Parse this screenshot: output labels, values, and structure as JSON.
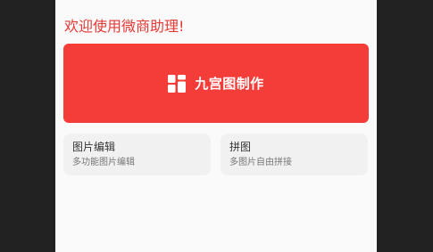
{
  "welcome_text": "欢迎使用微商助理!",
  "primary_action": {
    "label": "九宫图制作",
    "icon": "grid-icon"
  },
  "cards": [
    {
      "title": "图片编辑",
      "subtitle": "多功能图片编辑"
    },
    {
      "title": "拼图",
      "subtitle": "多图片自由拼接"
    }
  ],
  "colors": {
    "accent": "#f43c38",
    "welcome_text": "#e53935",
    "screen_bg": "#fafafa",
    "card_bg": "#f1f1f1",
    "outer_bg": "#222222"
  }
}
